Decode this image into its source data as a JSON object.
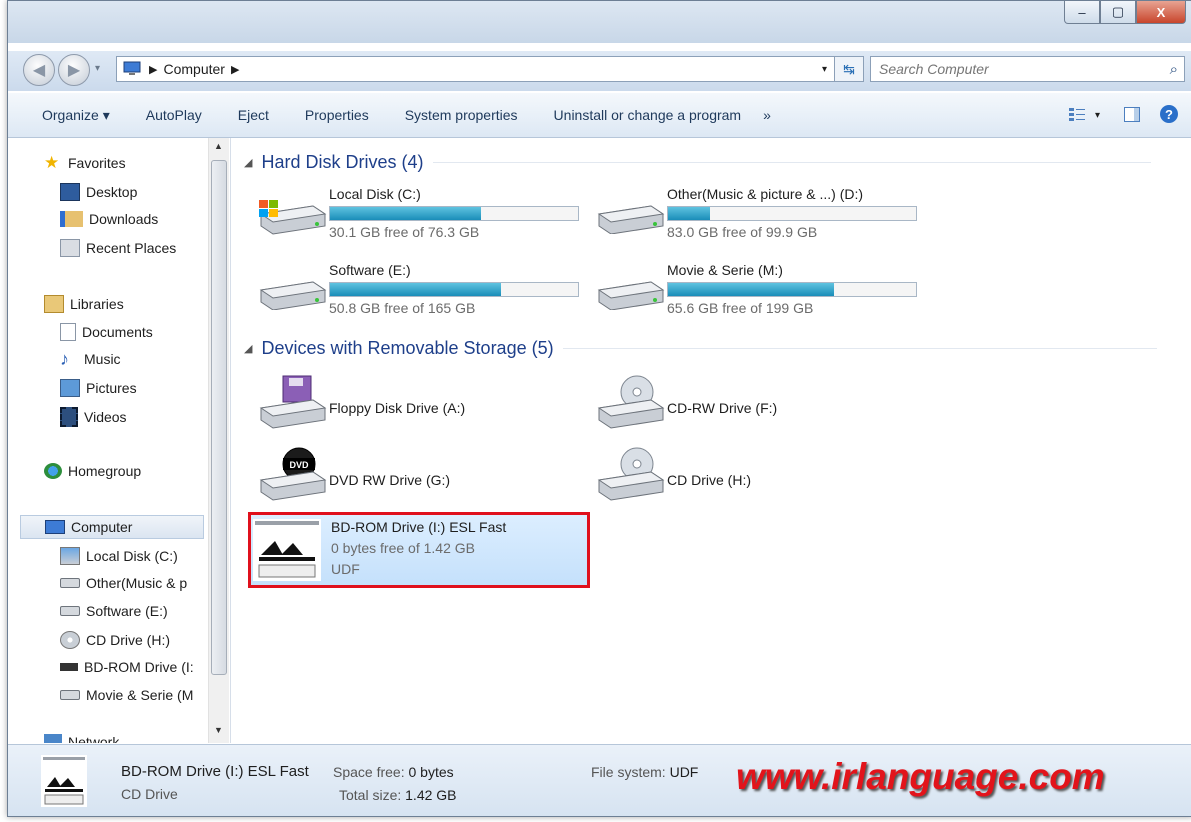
{
  "window": {
    "buttons": {
      "minimize": "–",
      "maximize": "▢",
      "close": "X"
    }
  },
  "address": {
    "segment": "Computer",
    "search_placeholder": "Search Computer"
  },
  "toolbar": {
    "items": [
      "Organize ▾",
      "AutoPlay",
      "Eject",
      "Properties",
      "System properties",
      "Uninstall or change a program",
      "»"
    ]
  },
  "sidebar": {
    "favorites": "Favorites",
    "fav_items": [
      "Desktop",
      "Downloads",
      "Recent Places"
    ],
    "libraries": "Libraries",
    "lib_items": [
      "Documents",
      "Music",
      "Pictures",
      "Videos"
    ],
    "homegroup": "Homegroup",
    "computer": "Computer",
    "computer_items": [
      "Local Disk (C:)",
      "Other(Music & p",
      "Software (E:)",
      "CD Drive (H:)",
      "BD-ROM Drive (I:",
      "Movie & Serie (M"
    ],
    "network": "Network"
  },
  "groups": {
    "hdd": "Hard Disk Drives (4)",
    "removable": "Devices with Removable Storage (5)"
  },
  "drives": [
    {
      "name": "Local Disk (C:)",
      "free": "30.1 GB free of 76.3 GB",
      "used_fraction": 0.61
    },
    {
      "name": "Other(Music & picture & ...) (D:)",
      "free": "83.0 GB free of 99.9 GB",
      "used_fraction": 0.17
    },
    {
      "name": "Software (E:)",
      "free": "50.8 GB free of 165 GB",
      "used_fraction": 0.69
    },
    {
      "name": "Movie & Serie (M:)",
      "free": "65.6 GB free of 199 GB",
      "used_fraction": 0.67
    }
  ],
  "devices": {
    "floppy": "Floppy Disk Drive (A:)",
    "cdrw": "CD-RW Drive (F:)",
    "dvd": "DVD RW Drive (G:)",
    "cd": "CD Drive (H:)",
    "dvd_badge": "DVD",
    "bdrom": {
      "name": "BD-ROM Drive (I:) ESL Fast",
      "free": "0 bytes free of 1.42 GB",
      "fs": "UDF"
    }
  },
  "status": {
    "name": "BD-ROM Drive (I:) ESL Fast",
    "type": "CD Drive",
    "space_free_label": "Space free:",
    "space_free": "0 bytes",
    "total_label": "Total size:",
    "total": "1.42 GB",
    "fs_label": "File system:",
    "fs": "UDF",
    "watermark": "www.irlanguage.com"
  },
  "colors": {
    "accent": "#1e3f8a",
    "bar_fill": "#1a8db8",
    "highlight_border": "#e0101c",
    "watermark": "#e2141b"
  }
}
